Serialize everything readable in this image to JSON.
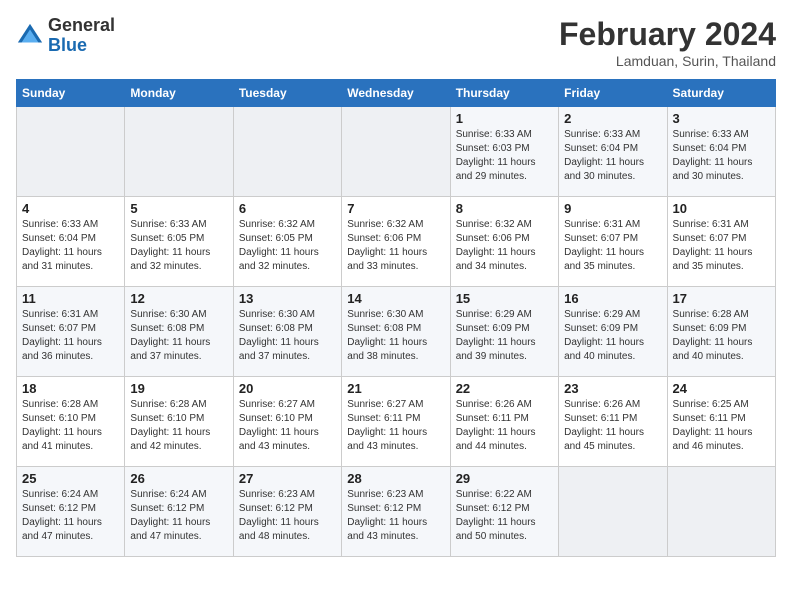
{
  "header": {
    "logo": {
      "line1": "General",
      "line2": "Blue"
    },
    "title": "February 2024",
    "subtitle": "Lamduan, Surin, Thailand"
  },
  "weekdays": [
    "Sunday",
    "Monday",
    "Tuesday",
    "Wednesday",
    "Thursday",
    "Friday",
    "Saturday"
  ],
  "weeks": [
    [
      {
        "day": "",
        "info": ""
      },
      {
        "day": "",
        "info": ""
      },
      {
        "day": "",
        "info": ""
      },
      {
        "day": "",
        "info": ""
      },
      {
        "day": "1",
        "info": "Sunrise: 6:33 AM\nSunset: 6:03 PM\nDaylight: 11 hours\nand 29 minutes."
      },
      {
        "day": "2",
        "info": "Sunrise: 6:33 AM\nSunset: 6:04 PM\nDaylight: 11 hours\nand 30 minutes."
      },
      {
        "day": "3",
        "info": "Sunrise: 6:33 AM\nSunset: 6:04 PM\nDaylight: 11 hours\nand 30 minutes."
      }
    ],
    [
      {
        "day": "4",
        "info": "Sunrise: 6:33 AM\nSunset: 6:04 PM\nDaylight: 11 hours\nand 31 minutes."
      },
      {
        "day": "5",
        "info": "Sunrise: 6:33 AM\nSunset: 6:05 PM\nDaylight: 11 hours\nand 32 minutes."
      },
      {
        "day": "6",
        "info": "Sunrise: 6:32 AM\nSunset: 6:05 PM\nDaylight: 11 hours\nand 32 minutes."
      },
      {
        "day": "7",
        "info": "Sunrise: 6:32 AM\nSunset: 6:06 PM\nDaylight: 11 hours\nand 33 minutes."
      },
      {
        "day": "8",
        "info": "Sunrise: 6:32 AM\nSunset: 6:06 PM\nDaylight: 11 hours\nand 34 minutes."
      },
      {
        "day": "9",
        "info": "Sunrise: 6:31 AM\nSunset: 6:07 PM\nDaylight: 11 hours\nand 35 minutes."
      },
      {
        "day": "10",
        "info": "Sunrise: 6:31 AM\nSunset: 6:07 PM\nDaylight: 11 hours\nand 35 minutes."
      }
    ],
    [
      {
        "day": "11",
        "info": "Sunrise: 6:31 AM\nSunset: 6:07 PM\nDaylight: 11 hours\nand 36 minutes."
      },
      {
        "day": "12",
        "info": "Sunrise: 6:30 AM\nSunset: 6:08 PM\nDaylight: 11 hours\nand 37 minutes."
      },
      {
        "day": "13",
        "info": "Sunrise: 6:30 AM\nSunset: 6:08 PM\nDaylight: 11 hours\nand 37 minutes."
      },
      {
        "day": "14",
        "info": "Sunrise: 6:30 AM\nSunset: 6:08 PM\nDaylight: 11 hours\nand 38 minutes."
      },
      {
        "day": "15",
        "info": "Sunrise: 6:29 AM\nSunset: 6:09 PM\nDaylight: 11 hours\nand 39 minutes."
      },
      {
        "day": "16",
        "info": "Sunrise: 6:29 AM\nSunset: 6:09 PM\nDaylight: 11 hours\nand 40 minutes."
      },
      {
        "day": "17",
        "info": "Sunrise: 6:28 AM\nSunset: 6:09 PM\nDaylight: 11 hours\nand 40 minutes."
      }
    ],
    [
      {
        "day": "18",
        "info": "Sunrise: 6:28 AM\nSunset: 6:10 PM\nDaylight: 11 hours\nand 41 minutes."
      },
      {
        "day": "19",
        "info": "Sunrise: 6:28 AM\nSunset: 6:10 PM\nDaylight: 11 hours\nand 42 minutes."
      },
      {
        "day": "20",
        "info": "Sunrise: 6:27 AM\nSunset: 6:10 PM\nDaylight: 11 hours\nand 43 minutes."
      },
      {
        "day": "21",
        "info": "Sunrise: 6:27 AM\nSunset: 6:11 PM\nDaylight: 11 hours\nand 43 minutes."
      },
      {
        "day": "22",
        "info": "Sunrise: 6:26 AM\nSunset: 6:11 PM\nDaylight: 11 hours\nand 44 minutes."
      },
      {
        "day": "23",
        "info": "Sunrise: 6:26 AM\nSunset: 6:11 PM\nDaylight: 11 hours\nand 45 minutes."
      },
      {
        "day": "24",
        "info": "Sunrise: 6:25 AM\nSunset: 6:11 PM\nDaylight: 11 hours\nand 46 minutes."
      }
    ],
    [
      {
        "day": "25",
        "info": "Sunrise: 6:24 AM\nSunset: 6:12 PM\nDaylight: 11 hours\nand 47 minutes."
      },
      {
        "day": "26",
        "info": "Sunrise: 6:24 AM\nSunset: 6:12 PM\nDaylight: 11 hours\nand 47 minutes."
      },
      {
        "day": "27",
        "info": "Sunrise: 6:23 AM\nSunset: 6:12 PM\nDaylight: 11 hours\nand 48 minutes."
      },
      {
        "day": "28",
        "info": "Sunrise: 6:23 AM\nSunset: 6:12 PM\nDaylight: 11 hours\nand 43 minutes."
      },
      {
        "day": "29",
        "info": "Sunrise: 6:22 AM\nSunset: 6:12 PM\nDaylight: 11 hours\nand 50 minutes."
      },
      {
        "day": "",
        "info": ""
      },
      {
        "day": "",
        "info": ""
      }
    ]
  ]
}
